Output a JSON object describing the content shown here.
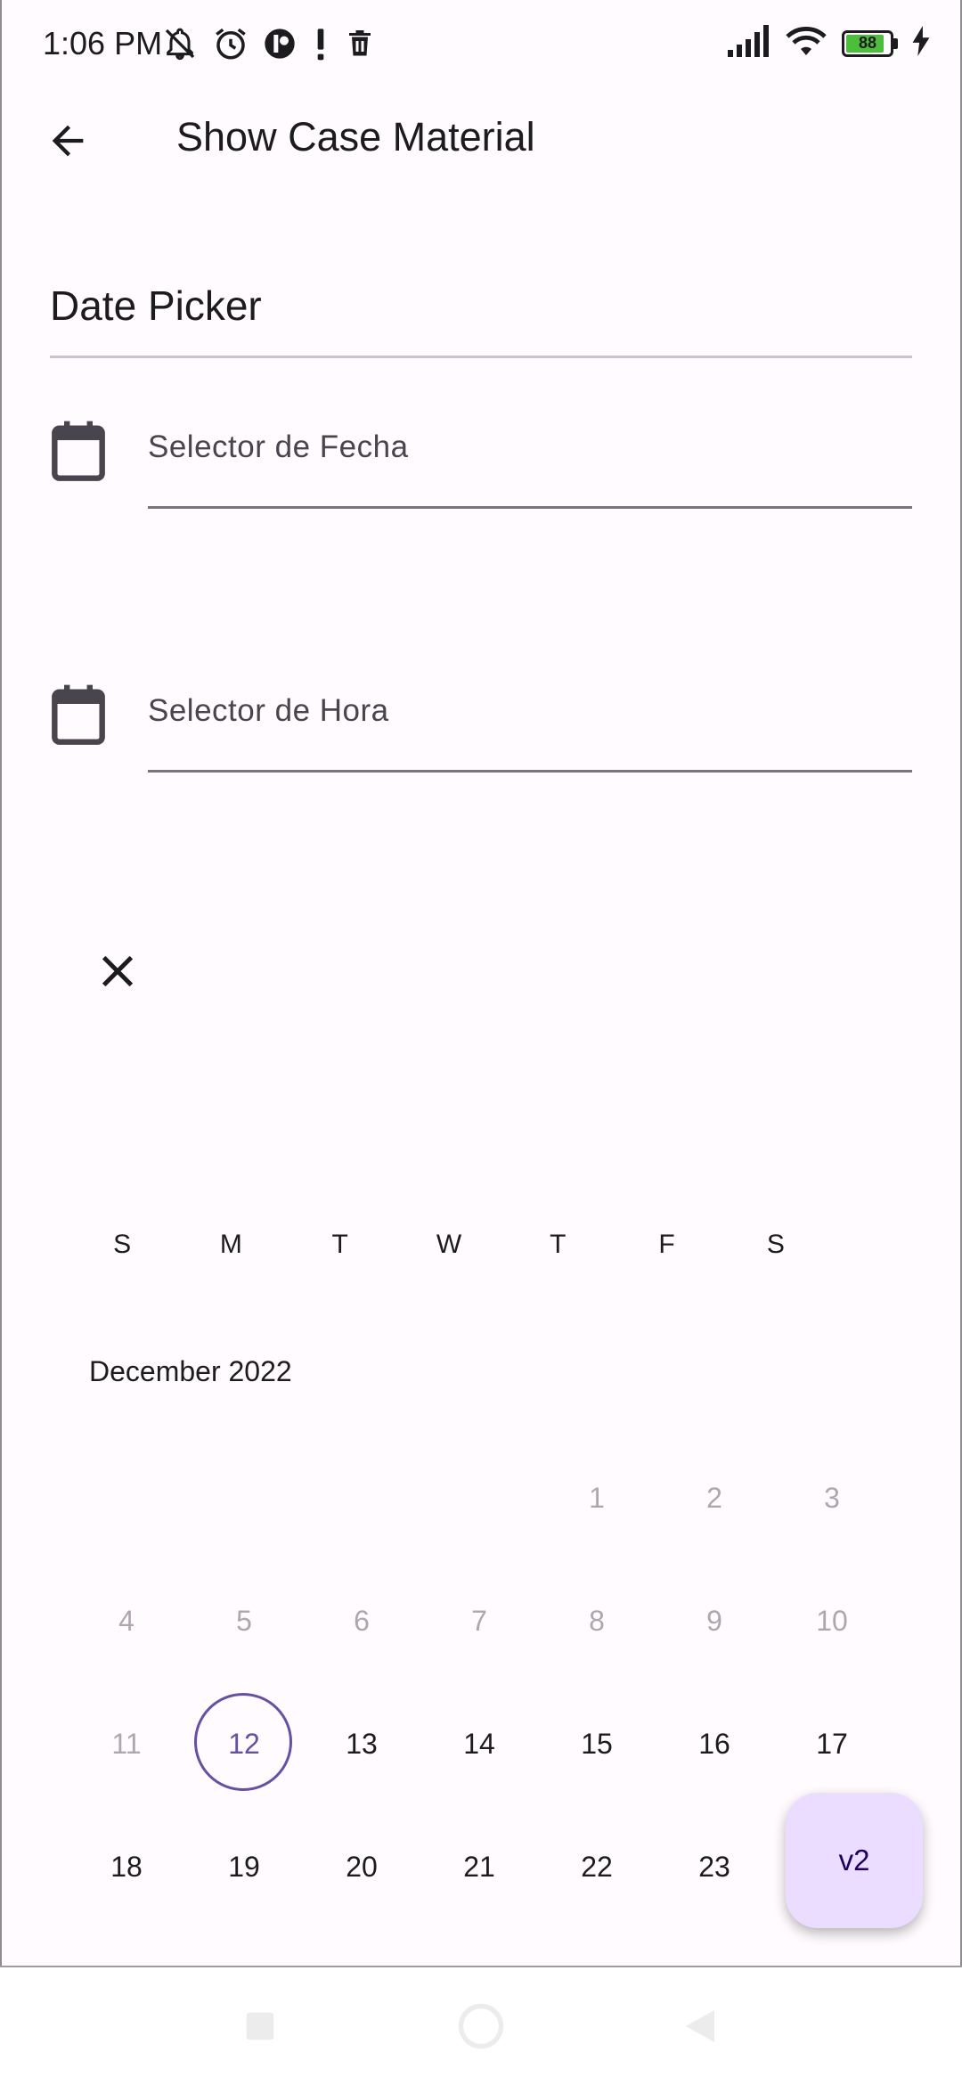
{
  "status_bar": {
    "time": "1:06 PM",
    "battery_level": "88",
    "battery_fraction": 0.88,
    "icons_left": [
      "mute-bell-icon",
      "alarm-icon",
      "app-icon",
      "alert-icon",
      "trash-icon"
    ],
    "icons_right": [
      "signal-icon",
      "wifi-icon",
      "battery-icon",
      "charging-icon"
    ]
  },
  "app_bar": {
    "title": "Show Case Material",
    "back_icon": "arrow-back-icon"
  },
  "section": {
    "title": "Date Picker"
  },
  "fields": [
    {
      "label": "Selector de Fecha",
      "icon": "calendar-icon"
    },
    {
      "label": "Selector de Hora",
      "icon": "calendar-icon"
    }
  ],
  "picker": {
    "close_icon": "close-icon",
    "weekdays": [
      "S",
      "M",
      "T",
      "W",
      "T",
      "F",
      "S"
    ],
    "month_label": "December 2022",
    "weeks": [
      [
        "",
        "",
        "",
        "",
        "1",
        "2",
        "3"
      ],
      [
        "4",
        "5",
        "6",
        "7",
        "8",
        "9",
        "10"
      ],
      [
        "11",
        "12",
        "13",
        "14",
        "15",
        "16",
        "17"
      ],
      [
        "18",
        "19",
        "20",
        "21",
        "22",
        "23",
        ""
      ]
    ],
    "today": "12"
  },
  "fab": {
    "label": "v2"
  },
  "colors": {
    "background": "#fffbfe",
    "primary": "#6750a4",
    "fab": "#eaddff",
    "disabled_text": "#aca8b0"
  }
}
